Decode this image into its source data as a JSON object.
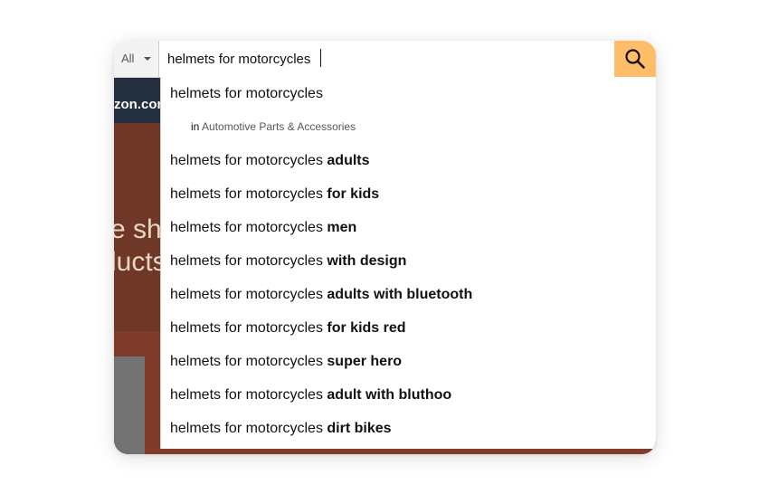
{
  "search": {
    "department": "All",
    "query": "helmets for motorcycles"
  },
  "background": {
    "nav_text": "zon.com",
    "hero_text": "e shi\nlucts"
  },
  "dropdown": {
    "top_suggestion": "helmets for motorcycles",
    "category_prefix": "in",
    "category": "Automotive Parts & Accessories",
    "suggestions": [
      {
        "base": "helmets for motorcycles",
        "suffix": "adults"
      },
      {
        "base": "helmets for motorcycles",
        "suffix": "for kids"
      },
      {
        "base": "helmets for motorcycles",
        "suffix": "men"
      },
      {
        "base": "helmets for motorcycles",
        "suffix": "with design"
      },
      {
        "base": "helmets for motorcycles",
        "suffix": "adults with bluetooth"
      },
      {
        "base": "helmets for motorcycles",
        "suffix": "for kids red"
      },
      {
        "base": "helmets for motorcycles",
        "suffix": "super hero"
      },
      {
        "base": "helmets for motorcycles",
        "suffix": "adult with bluthoo"
      },
      {
        "base": "helmets for motorcycles",
        "suffix": "dirt bikes"
      }
    ]
  },
  "colors": {
    "search_button": "#febd69",
    "nav": "#232f3e"
  }
}
